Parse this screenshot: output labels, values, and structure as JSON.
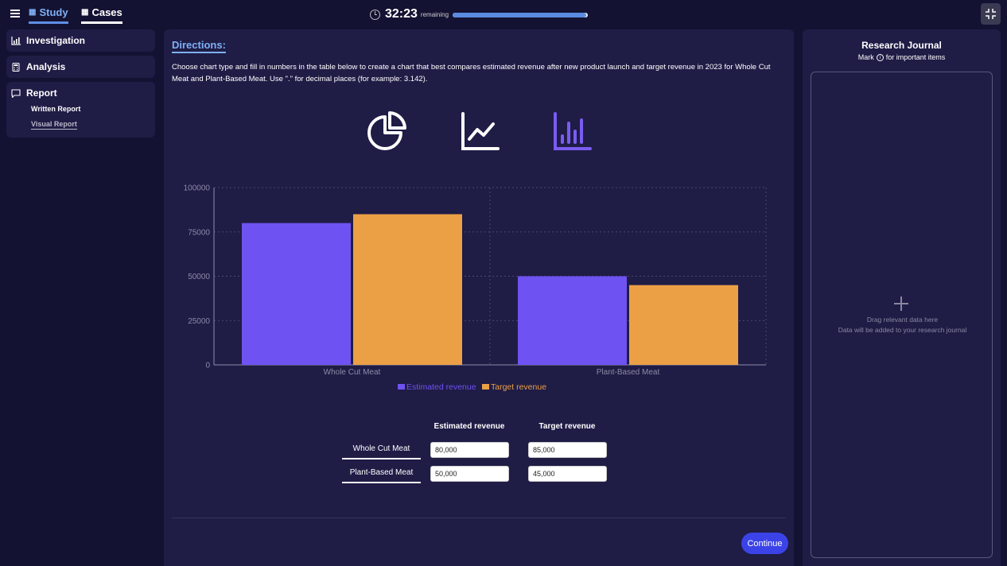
{
  "header": {
    "tabs": [
      {
        "label": "Study",
        "icon": "calendar-icon",
        "active": true
      },
      {
        "label": "Cases",
        "icon": "calendar-icon",
        "active": false
      }
    ],
    "timer": {
      "value": "32:23",
      "label": "remaining",
      "progress": 0.99
    },
    "collapse_icon": "collapse-icon"
  },
  "sidebar": {
    "items": [
      {
        "label": "Investigation",
        "icon": "bar-chart-icon"
      },
      {
        "label": "Analysis",
        "icon": "calculator-icon"
      },
      {
        "label": "Report",
        "icon": "chat-icon",
        "sub_items": [
          "Written Report",
          "Visual Report"
        ],
        "active_sub": "Visual Report"
      }
    ]
  },
  "main": {
    "directions_title": "Directions:",
    "directions_text": "Choose chart type and fill in numbers in the table below to create a chart that best compares estimated revenue after new product launch and target revenue in 2023 for Whole Cut Meat and Plant-Based Meat. Use \".\" for decimal places (for example: 3.142).",
    "chart_types": [
      "pie-chart-icon",
      "line-chart-icon",
      "bar-chart-icon"
    ],
    "selected_chart_type": "bar-chart-icon",
    "table": {
      "headers": [
        "Estimated revenue",
        "Target revenue"
      ],
      "rows": [
        {
          "label": "Whole Cut Meat",
          "values": [
            "80,000",
            "85,000"
          ]
        },
        {
          "label": "Plant-Based Meat",
          "values": [
            "50,000",
            "45,000"
          ]
        }
      ]
    },
    "continue_label": "Continue"
  },
  "chart_data": {
    "type": "bar",
    "categories": [
      "Whole Cut Meat",
      "Plant-Based Meat"
    ],
    "series": [
      {
        "name": "Estimated revenue",
        "values": [
          80000,
          50000
        ],
        "color": "#6f52f2"
      },
      {
        "name": "Target revenue",
        "values": [
          85000,
          45000
        ],
        "color": "#eca045"
      }
    ],
    "yticks": [
      "0",
      "25000",
      "50000",
      "75000",
      "100000"
    ],
    "ylim": [
      0,
      100000
    ],
    "grid": true,
    "legend": "bottom-center"
  },
  "journal": {
    "title": "Research Journal",
    "sub_prefix": "Mark",
    "sub_suffix": "for important items",
    "drop_line1": "Drag relevant data here",
    "drop_line2": "Data will be added to your research journal"
  }
}
